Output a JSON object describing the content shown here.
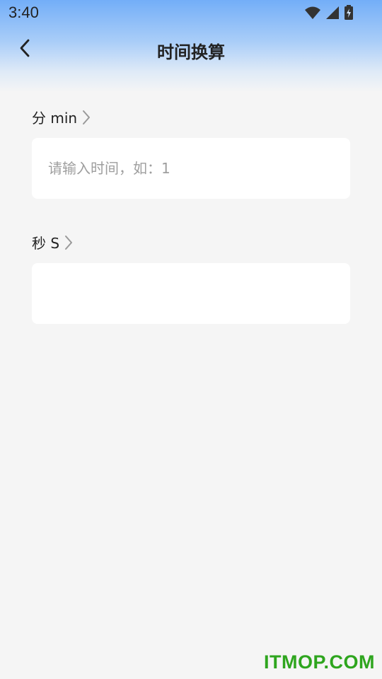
{
  "status_bar": {
    "time": "3:40"
  },
  "nav": {
    "title": "时间换算",
    "back_icon": "chevron-left-icon"
  },
  "minutes": {
    "label": "分 min",
    "placeholder": "请输入时间，如：1",
    "value": ""
  },
  "seconds": {
    "label": "秒 S",
    "placeholder": "",
    "value": ""
  },
  "watermark": "ITMOP.COM",
  "colors": {
    "gradient_top": "#73aef8",
    "background": "#f5f5f5",
    "card": "#ffffff",
    "watermark": "#2ea51e"
  }
}
